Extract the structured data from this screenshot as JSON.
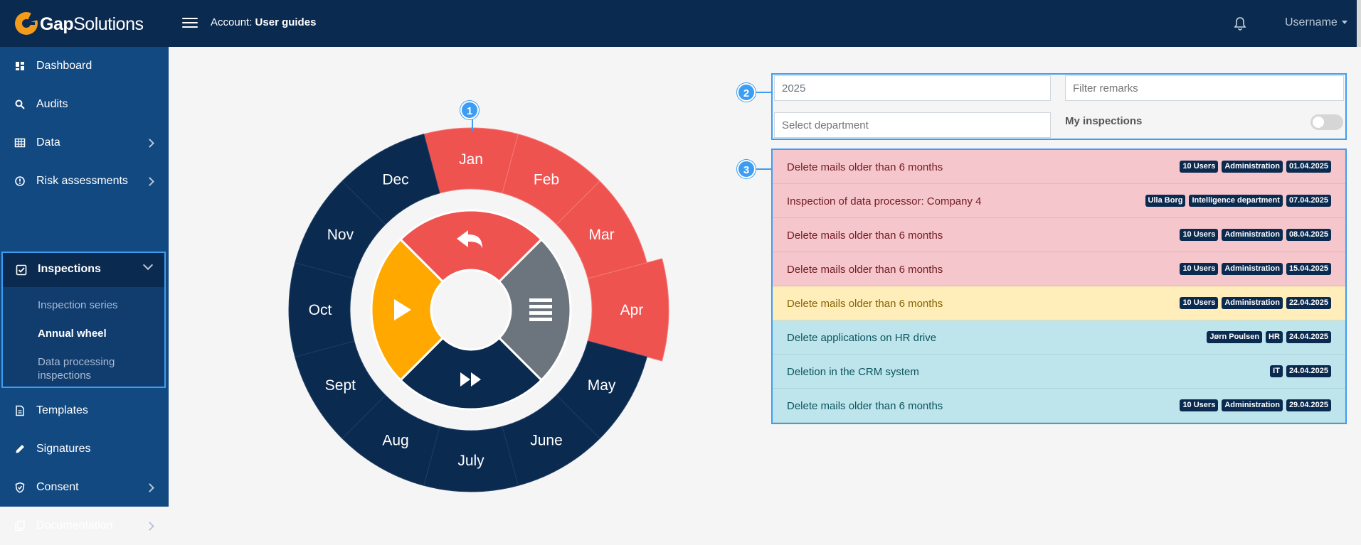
{
  "colors": {
    "accent": "#3d9df3",
    "navy": "#0b2a4f",
    "sidebar": "#134981",
    "red": "#ef5350",
    "orange": "#ffa800",
    "gray": "#6c757d"
  },
  "header": {
    "brand_bold": "Gap",
    "brand_rest": "Solutions",
    "account_label": "Account:",
    "account_name": "User guides",
    "username": "Username",
    "icons": [
      "logo-icon",
      "hamburger-icon",
      "bell-icon"
    ]
  },
  "sidebar": {
    "items": [
      {
        "label": "Dashboard",
        "icon": "dashboard-icon"
      },
      {
        "label": "Audits",
        "icon": "search-icon"
      },
      {
        "label": "Data",
        "icon": "table-icon"
      },
      {
        "label": "Risk assessments",
        "icon": "info-icon"
      },
      {
        "label": "Inspections",
        "icon": "checkbox-icon"
      },
      {
        "label": "Templates",
        "icon": "document-icon"
      },
      {
        "label": "Signatures",
        "icon": "pen-icon"
      },
      {
        "label": "Consent",
        "icon": "shield-icon"
      },
      {
        "label": "Documentation",
        "icon": "copy-icon"
      }
    ],
    "inspections_sub": [
      "Inspection series",
      "Annual wheel",
      "Data processing inspections"
    ]
  },
  "wheel": {
    "months": [
      "Jan",
      "Feb",
      "Mar",
      "Apr",
      "May",
      "June",
      "July",
      "Aug",
      "Sept",
      "Oct",
      "Nov",
      "Dec"
    ],
    "highlighted_months": [
      "Jan",
      "Feb",
      "Mar",
      "Apr"
    ],
    "selected_month": "Apr",
    "controls": [
      "back-icon",
      "list-icon",
      "fast-forward-icon",
      "play-icon"
    ]
  },
  "markers": {
    "m1": "1",
    "m2": "2",
    "m3": "3"
  },
  "filters": {
    "year_value": "2025",
    "remarks_placeholder": "Filter remarks",
    "department_placeholder": "Select department",
    "my_inspections_label": "My inspections",
    "my_inspections_on": false
  },
  "inspections": [
    {
      "title": "Delete mails older than 6 months",
      "tags": [
        "10 Users",
        "Administration",
        "01.04.2025"
      ],
      "status": "red"
    },
    {
      "title": "Inspection of data processor: Company 4",
      "tags": [
        "Ulla Borg",
        "Intelligence department",
        "07.04.2025"
      ],
      "status": "red"
    },
    {
      "title": "Delete mails older than 6 months",
      "tags": [
        "10 Users",
        "Administration",
        "08.04.2025"
      ],
      "status": "red"
    },
    {
      "title": "Delete mails older than 6 months",
      "tags": [
        "10 Users",
        "Administration",
        "15.04.2025"
      ],
      "status": "red"
    },
    {
      "title": "Delete mails older than 6 months",
      "tags": [
        "10 Users",
        "Administration",
        "22.04.2025"
      ],
      "status": "yellow"
    },
    {
      "title": "Delete applications on HR drive",
      "tags": [
        "Jørn Poulsen",
        "HR",
        "24.04.2025"
      ],
      "status": "cyan"
    },
    {
      "title": "Deletion in the CRM system",
      "tags": [
        "IT",
        "24.04.2025"
      ],
      "status": "cyan"
    },
    {
      "title": "Delete mails older than 6 months",
      "tags": [
        "10 Users",
        "Administration",
        "29.04.2025"
      ],
      "status": "cyan"
    }
  ]
}
